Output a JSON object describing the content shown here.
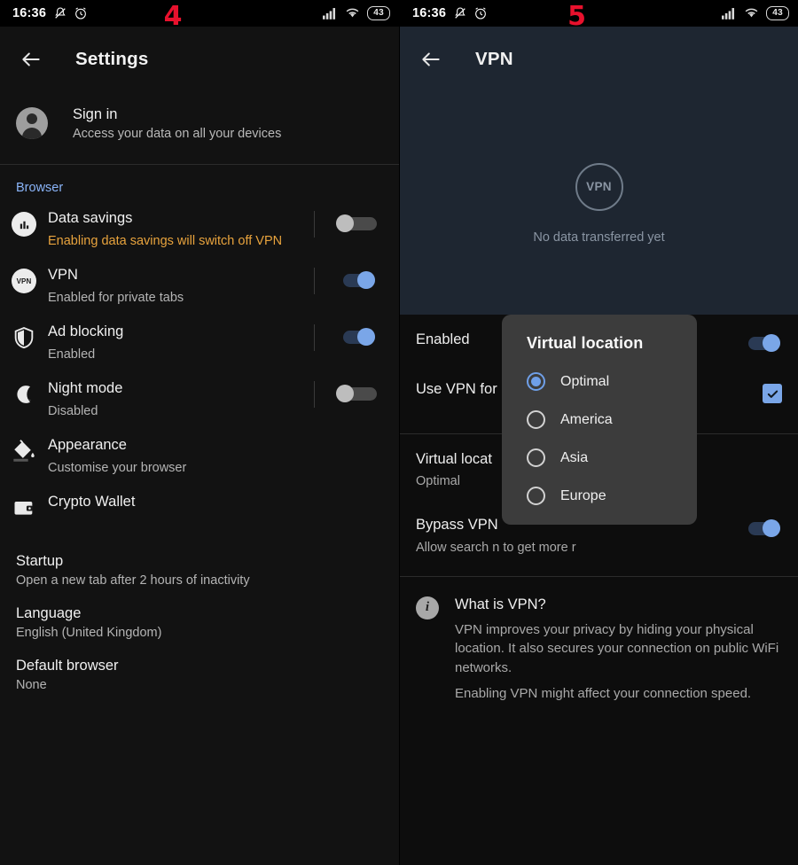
{
  "statusbar": {
    "time": "16:36",
    "battery": "43",
    "icons": [
      "bell-muted-icon",
      "alarm-clock-icon",
      "signal-icon",
      "wifi-icon",
      "battery-icon"
    ]
  },
  "markers": {
    "left": "4",
    "right": "5"
  },
  "left_panel": {
    "appbar": {
      "title": "Settings",
      "back": "back-arrow-icon"
    },
    "account": {
      "title": "Sign in",
      "subtitle": "Access your data on all your devices"
    },
    "section_header": "Browser",
    "items": [
      {
        "icon": "bar-chart-icon",
        "title": "Data savings",
        "subtitle": "Enabling data savings will switch off VPN",
        "subtitle_warning": true,
        "control": "toggle",
        "state": "off"
      },
      {
        "icon": "vpn-badge-icon",
        "title": "VPN",
        "subtitle": "Enabled for private tabs",
        "subtitle_warning": false,
        "control": "toggle",
        "state": "on"
      },
      {
        "icon": "shield-icon",
        "title": "Ad blocking",
        "subtitle": "Enabled",
        "subtitle_warning": false,
        "control": "toggle",
        "state": "on"
      },
      {
        "icon": "moon-icon",
        "title": "Night mode",
        "subtitle": "Disabled",
        "subtitle_warning": false,
        "control": "toggle",
        "state": "off"
      },
      {
        "icon": "paint-bucket-icon",
        "title": "Appearance",
        "subtitle": "Customise your browser",
        "subtitle_warning": false,
        "control": "none",
        "state": ""
      },
      {
        "icon": "wallet-icon",
        "title": "Crypto Wallet",
        "subtitle": "",
        "subtitle_warning": false,
        "control": "none",
        "state": ""
      }
    ],
    "plain_items": [
      {
        "title": "Startup",
        "subtitle": "Open a new tab after 2 hours of inactivity"
      },
      {
        "title": "Language",
        "subtitle": "English (United Kingdom)"
      },
      {
        "title": "Default browser",
        "subtitle": "None"
      }
    ]
  },
  "right_panel": {
    "appbar": {
      "title": "VPN",
      "back": "back-arrow-icon"
    },
    "hero": {
      "logo_text": "VPN",
      "status_text": "No data transferred yet"
    },
    "rows": [
      {
        "title": "Enabled",
        "subtitle": "",
        "control": "toggle",
        "state": "on"
      },
      {
        "title": "Use VPN for",
        "subtitle": "",
        "control": "checkbox",
        "state": "checked"
      },
      {
        "title": "Virtual locat",
        "subtitle": "Optimal",
        "control": "none",
        "state": ""
      },
      {
        "title": "Bypass VPN",
        "subtitle": "Allow search                                    n to get more r",
        "control": "toggle",
        "state": "on"
      }
    ],
    "info": {
      "icon": "info-icon",
      "title": "What is VPN?",
      "paragraph1": "VPN improves your privacy by hiding your physical location. It also secures your connection on public WiFi networks.",
      "paragraph2": "Enabling VPN might affect your connection speed."
    },
    "dialog": {
      "title": "Virtual location",
      "options": [
        {
          "label": "Optimal",
          "selected": true
        },
        {
          "label": "America",
          "selected": false
        },
        {
          "label": "Asia",
          "selected": false
        },
        {
          "label": "Europe",
          "selected": false
        }
      ]
    }
  },
  "colors": {
    "accent_blue": "#7aa6e8",
    "section_blue": "#8ab4f8",
    "warning_orange": "#e8a33d",
    "marker_red": "#e8112d",
    "hero_navy": "#1e2631",
    "dialog_grey": "#3c3c3c"
  }
}
